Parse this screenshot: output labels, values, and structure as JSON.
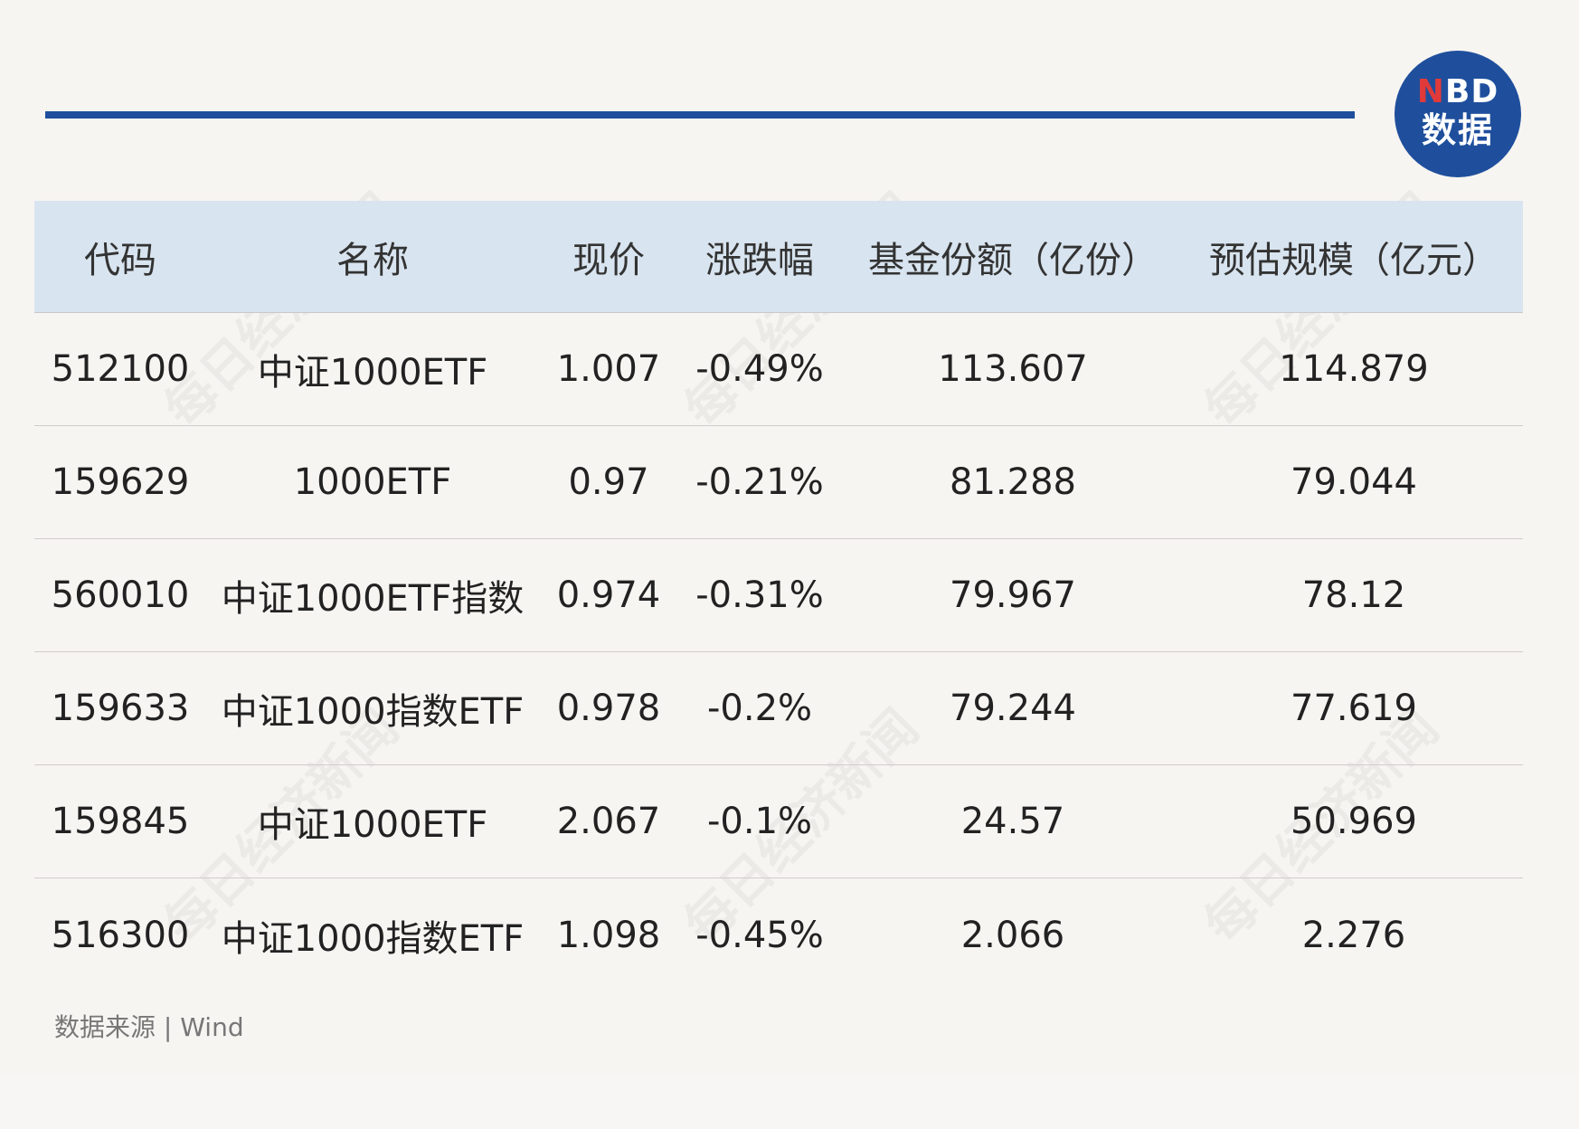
{
  "logo": {
    "line1_n": "N",
    "line1_rest": "BD",
    "line2": "数据"
  },
  "table": {
    "headers": [
      "代码",
      "名称",
      "现价",
      "涨跌幅",
      "基金份额（亿份）",
      "预估规模（亿元）"
    ],
    "rows": [
      [
        "512100",
        "中证1000ETF",
        "1.007",
        "-0.49%",
        "113.607",
        "114.879"
      ],
      [
        "159629",
        "1000ETF",
        "0.97",
        "-0.21%",
        "81.288",
        "79.044"
      ],
      [
        "560010",
        "中证1000ETF指数",
        "0.974",
        "-0.31%",
        "79.967",
        "78.12"
      ],
      [
        "159633",
        "中证1000指数ETF",
        "0.978",
        "-0.2%",
        "79.244",
        "77.619"
      ],
      [
        "159845",
        "中证1000ETF",
        "2.067",
        "-0.1%",
        "24.57",
        "50.969"
      ],
      [
        "516300",
        "中证1000指数ETF",
        "1.098",
        "-0.45%",
        "2.066",
        "2.276"
      ]
    ]
  },
  "footnote": "数据来源 | Wind",
  "watermark": "每日经济新闻",
  "colors": {
    "accent": "#1f4f9c",
    "header_bg": "#d8e4ef",
    "logo_n": "#e03a3a"
  }
}
